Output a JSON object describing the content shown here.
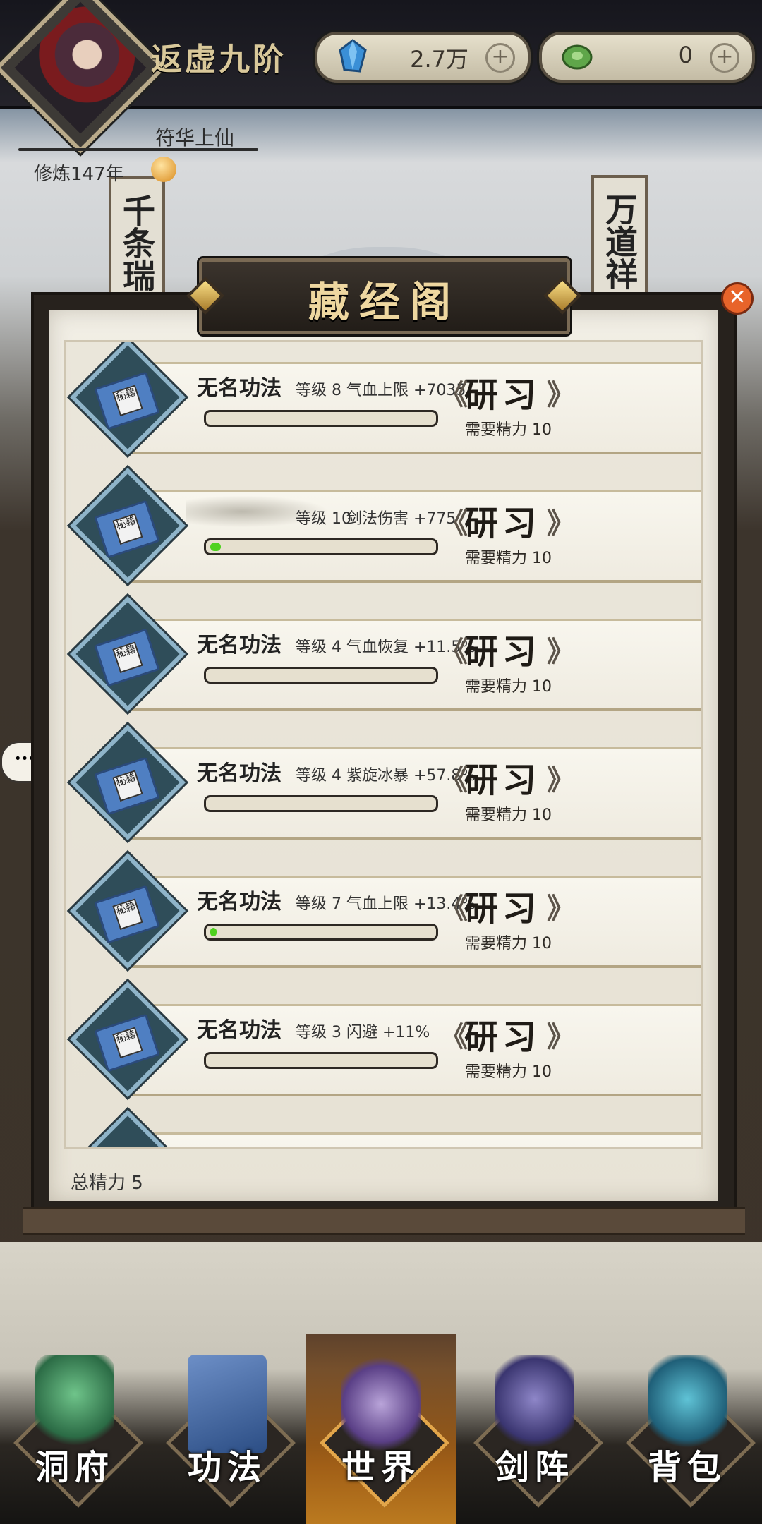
{
  "header": {
    "realm_title": "返虚九阶",
    "currency_1": {
      "value": "2.7万",
      "icon": "blue-crystal-icon",
      "add_label": "+"
    },
    "currency_2": {
      "value": "0",
      "icon": "jade-coin-icon",
      "add_label": "+"
    },
    "player_name": "符华上仙",
    "cultivation_years": "修炼147年"
  },
  "scene": {
    "left_scroll": "千条瑞",
    "right_scroll": "万道祥"
  },
  "panel": {
    "title": "藏经阁",
    "close_icon": "close-x-icon",
    "total_energy_label": "总精力 5"
  },
  "skills": [
    {
      "name": "无名功法",
      "level": "等级 8",
      "stat": "气血上限 +7035",
      "progress": 0.0,
      "button": "研习",
      "cost": "需要精力 10"
    },
    {
      "name": "",
      "level": "等级 10",
      "stat": "剑法伤害 +775",
      "progress": 0.05,
      "button": "研习",
      "cost": "需要精力 10"
    },
    {
      "name": "无名功法",
      "level": "等级 4",
      "stat": "气血恢复 +11.5%",
      "progress": 0.0,
      "button": "研习",
      "cost": "需要精力 10"
    },
    {
      "name": "无名功法",
      "level": "等级 4",
      "stat": "紫旋冰暴 +57.8%",
      "progress": 0.0,
      "button": "研习",
      "cost": "需要精力 10"
    },
    {
      "name": "无名功法",
      "level": "等级 7",
      "stat": "气血上限 +13.4%",
      "progress": 0.03,
      "button": "研习",
      "cost": "需要精力 10"
    },
    {
      "name": "无名功法",
      "level": "等级 3",
      "stat": "闪避 +11%",
      "progress": 0.0,
      "button": "研习",
      "cost": "需要精力 10"
    }
  ],
  "book_label": "秘籍",
  "nav": [
    {
      "label": "洞府",
      "icon": "cave-residence-icon"
    },
    {
      "label": "功法",
      "icon": "skill-book-icon"
    },
    {
      "label": "世界",
      "icon": "world-map-icon"
    },
    {
      "label": "剑阵",
      "icon": "sword-formation-icon"
    },
    {
      "label": "背包",
      "icon": "bag-icon"
    }
  ],
  "colors": {
    "progress_fill": "#4fd21f",
    "title_text": "#eed7a0",
    "paper": "#f1eee5"
  }
}
